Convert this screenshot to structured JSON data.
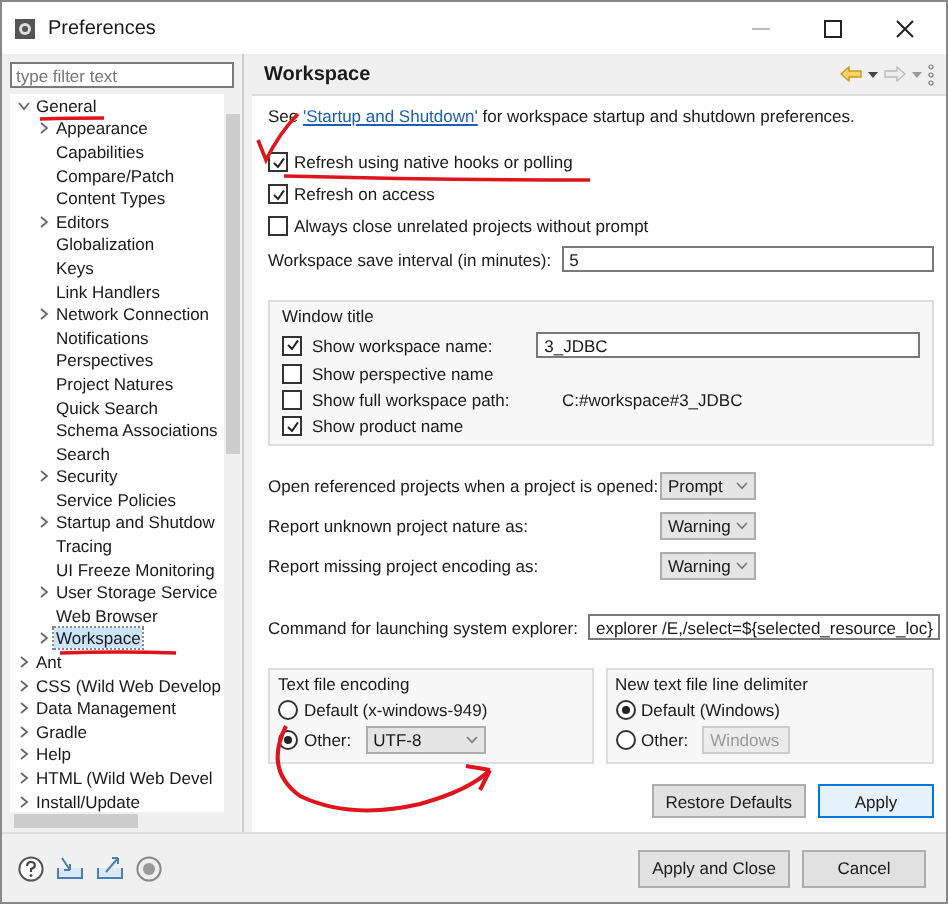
{
  "window": {
    "title": "Preferences"
  },
  "filter": {
    "placeholder": "type filter text"
  },
  "tree": [
    {
      "label": "General",
      "expanded": true,
      "selected": false,
      "children": [
        {
          "label": "Appearance",
          "expanded": false,
          "selected": false
        },
        {
          "label": "Capabilities",
          "selected": false
        },
        {
          "label": "Compare/Patch",
          "selected": false
        },
        {
          "label": "Content Types",
          "selected": false
        },
        {
          "label": "Editors",
          "expanded": false,
          "selected": false
        },
        {
          "label": "Globalization",
          "selected": false
        },
        {
          "label": "Keys",
          "selected": false
        },
        {
          "label": "Link Handlers",
          "selected": false
        },
        {
          "label": "Network Connection",
          "expanded": false,
          "selected": false
        },
        {
          "label": "Notifications",
          "selected": false
        },
        {
          "label": "Perspectives",
          "selected": false
        },
        {
          "label": "Project Natures",
          "selected": false
        },
        {
          "label": "Quick Search",
          "selected": false
        },
        {
          "label": "Schema Associations",
          "selected": false
        },
        {
          "label": "Search",
          "selected": false
        },
        {
          "label": "Security",
          "expanded": false,
          "selected": false
        },
        {
          "label": "Service Policies",
          "selected": false
        },
        {
          "label": "Startup and Shutdow",
          "expanded": false,
          "selected": false
        },
        {
          "label": "Tracing",
          "selected": false
        },
        {
          "label": "UI Freeze Monitoring",
          "selected": false
        },
        {
          "label": "User Storage Service",
          "expanded": false,
          "selected": false
        },
        {
          "label": "Web Browser",
          "selected": false
        },
        {
          "label": "Workspace",
          "expanded": false,
          "selected": true
        }
      ]
    },
    {
      "label": "Ant",
      "expanded": false,
      "selected": false
    },
    {
      "label": "CSS (Wild Web Develop",
      "expanded": false,
      "selected": false
    },
    {
      "label": "Data Management",
      "expanded": false,
      "selected": false
    },
    {
      "label": "Gradle",
      "expanded": false,
      "selected": false
    },
    {
      "label": "Help",
      "expanded": false,
      "selected": false
    },
    {
      "label": "HTML (Wild Web Devel",
      "expanded": false,
      "selected": false
    },
    {
      "label": "Install/Update",
      "expanded": false,
      "selected": false
    }
  ],
  "page": {
    "title": "Workspace",
    "intro": {
      "before": "See ",
      "link": "'Startup and Shutdown'",
      "after": " for workspace startup and shutdown preferences."
    },
    "options": [
      {
        "label": "Refresh using native hooks or polling",
        "checked": true
      },
      {
        "label": "Refresh on access",
        "checked": true
      },
      {
        "label": "Always close unrelated projects without prompt",
        "checked": false
      }
    ],
    "save_interval": {
      "label": "Workspace save interval (in minutes):",
      "value": "5"
    },
    "window_title": {
      "title": "Window title",
      "rows": [
        {
          "kind": "field",
          "label": "Show workspace name:",
          "checked": true,
          "value": "3_JDBC"
        },
        {
          "kind": "plain",
          "label": "Show perspective name",
          "checked": false
        },
        {
          "kind": "path",
          "label": "Show full workspace path:",
          "checked": false,
          "path": "C:#workspace#3_JDBC"
        },
        {
          "kind": "plain",
          "label": "Show product name",
          "checked": true
        }
      ]
    },
    "selects": [
      {
        "label": "Open referenced projects when a project is opened:",
        "value": "Prompt"
      },
      {
        "label": "Report unknown project nature as:",
        "value": "Warning"
      },
      {
        "label": "Report missing project encoding as:",
        "value": "Warning"
      }
    ],
    "command": {
      "label": "Command for launching system explorer:",
      "value": "explorer /E,/select=${selected_resource_loc}"
    },
    "encoding": {
      "title": "Text file encoding",
      "options": [
        {
          "label": "Default (x-windows-949)",
          "selected": false
        },
        {
          "label": "Other:",
          "selected": true,
          "value": "UTF-8"
        }
      ]
    },
    "delimiter": {
      "title": "New text file line delimiter",
      "options": [
        {
          "label": "Default (Windows)",
          "selected": true
        },
        {
          "label": "Other:",
          "selected": false,
          "value": "Windows"
        }
      ]
    },
    "buttons": [
      "Restore Defaults",
      "Apply"
    ]
  },
  "footer_buttons": [
    "Apply and Close",
    "Cancel"
  ]
}
